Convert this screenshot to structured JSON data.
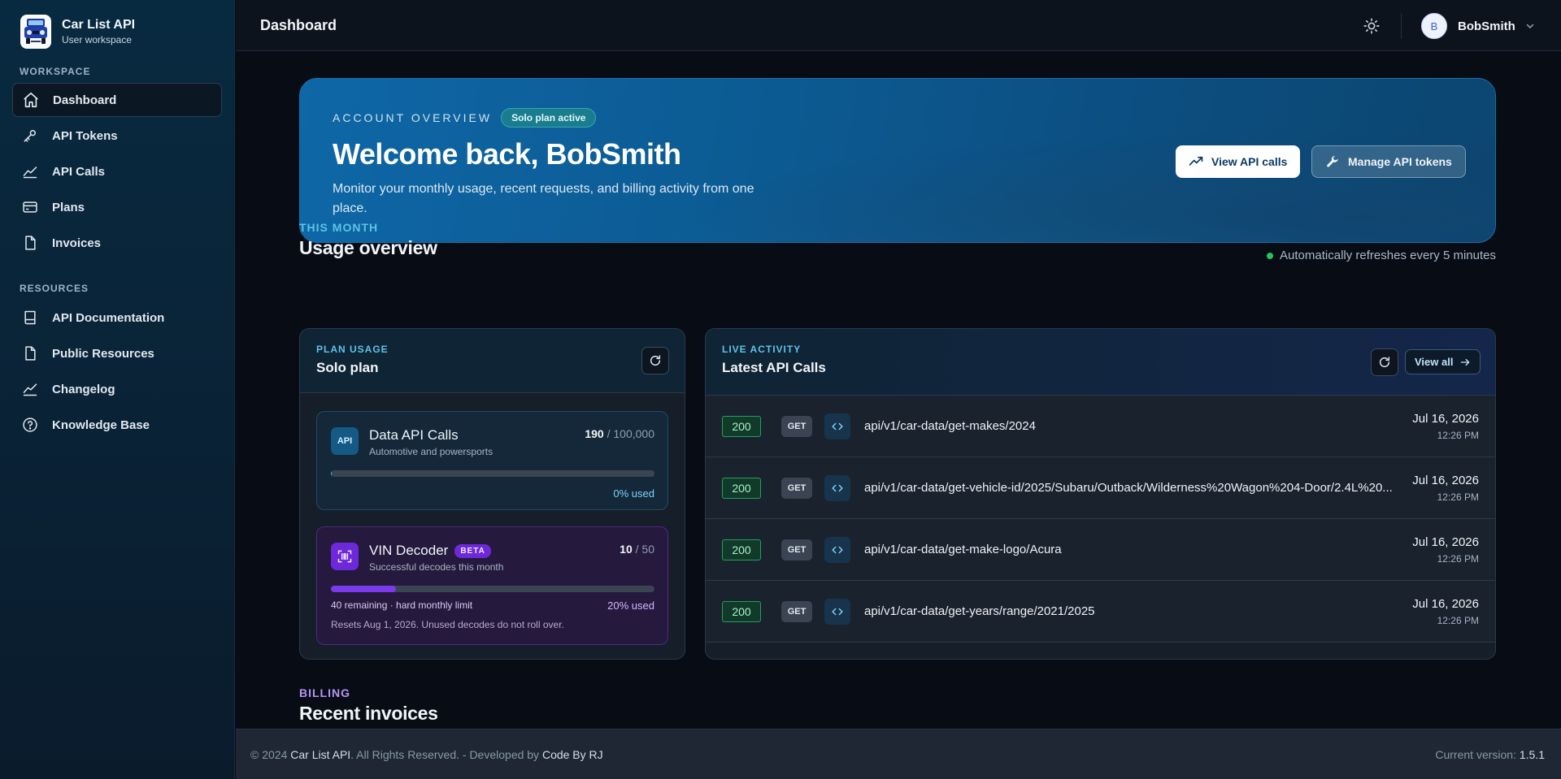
{
  "brand": {
    "name": "Car List API",
    "subtitle": "User workspace"
  },
  "sidebar": {
    "workspace_label": "WORKSPACE",
    "workspace_items": [
      {
        "label": "Dashboard",
        "icon": "home-icon",
        "active": true
      },
      {
        "label": "API Tokens",
        "icon": "key-icon"
      },
      {
        "label": "API Calls",
        "icon": "chart-line-icon"
      },
      {
        "label": "Plans",
        "icon": "credit-card-icon"
      },
      {
        "label": "Invoices",
        "icon": "document-icon"
      }
    ],
    "resources_label": "RESOURCES",
    "resources_items": [
      {
        "label": "API Documentation",
        "icon": "book-icon"
      },
      {
        "label": "Public Resources",
        "icon": "document-icon"
      },
      {
        "label": "Changelog",
        "icon": "activity-icon"
      },
      {
        "label": "Knowledge Base",
        "icon": "question-circle-icon"
      }
    ]
  },
  "topbar": {
    "title": "Dashboard",
    "user_initial": "B",
    "user_name": "BobSmith"
  },
  "hero": {
    "eyebrow": "ACCOUNT OVERVIEW",
    "pill": "Solo plan active",
    "title": "Welcome back, BobSmith",
    "description": "Monitor your monthly usage, recent requests, and billing activity from one place.",
    "primary_button": "View API calls",
    "secondary_button": "Manage API tokens"
  },
  "usage": {
    "eyebrow": "THIS MONTH",
    "title": "Usage overview",
    "refresh_note": "Automatically refreshes every 5 minutes"
  },
  "plan_card": {
    "eyebrow": "PLAN USAGE",
    "title": "Solo plan",
    "data_api": {
      "icon_text": "API",
      "name": "Data API Calls",
      "sub": "Automotive and powersports",
      "used": "190",
      "limit": "/ 100,000",
      "pct_label": "0% used",
      "fraction": 0.0019
    },
    "vin": {
      "name": "VIN Decoder",
      "badge": "BETA",
      "sub": "Successful decodes this month",
      "used": "10",
      "limit": "/ 50",
      "remaining": "40 remaining · hard monthly limit",
      "pct_label": "20% used",
      "reset": "Resets Aug 1, 2026. Unused decodes do not roll over.",
      "fraction": 0.2
    }
  },
  "calls_card": {
    "eyebrow": "LIVE ACTIVITY",
    "title": "Latest API Calls",
    "view_all": "View all",
    "rows": [
      {
        "status": "200",
        "method": "GET",
        "endpoint": "api/v1/car-data/get-makes/2024",
        "date": "Jul 16, 2026",
        "time": "12:26 PM"
      },
      {
        "status": "200",
        "method": "GET",
        "endpoint": "api/v1/car-data/get-vehicle-id/2025/Subaru/Outback/Wilderness%20Wagon%204-Door/2.4L%20...",
        "date": "Jul 16, 2026",
        "time": "12:26 PM"
      },
      {
        "status": "200",
        "method": "GET",
        "endpoint": "api/v1/car-data/get-make-logo/Acura",
        "date": "Jul 16, 2026",
        "time": "12:26 PM"
      },
      {
        "status": "200",
        "method": "GET",
        "endpoint": "api/v1/car-data/get-years/range/2021/2025",
        "date": "Jul 16, 2026",
        "time": "12:26 PM"
      }
    ]
  },
  "billing": {
    "eyebrow": "BILLING",
    "title": "Recent invoices"
  },
  "footer": {
    "copyright": "© 2024",
    "company": "Car List API",
    "rights": ". All Rights Reserved. - Developed by",
    "developer": "Code By RJ",
    "version_label": "Current version:",
    "version": "1.5.1"
  },
  "colors": {
    "accent": "#5fc3e8",
    "success": "#22c55e",
    "vin_purple": "#7c3aed",
    "billing": "#b794f6"
  }
}
